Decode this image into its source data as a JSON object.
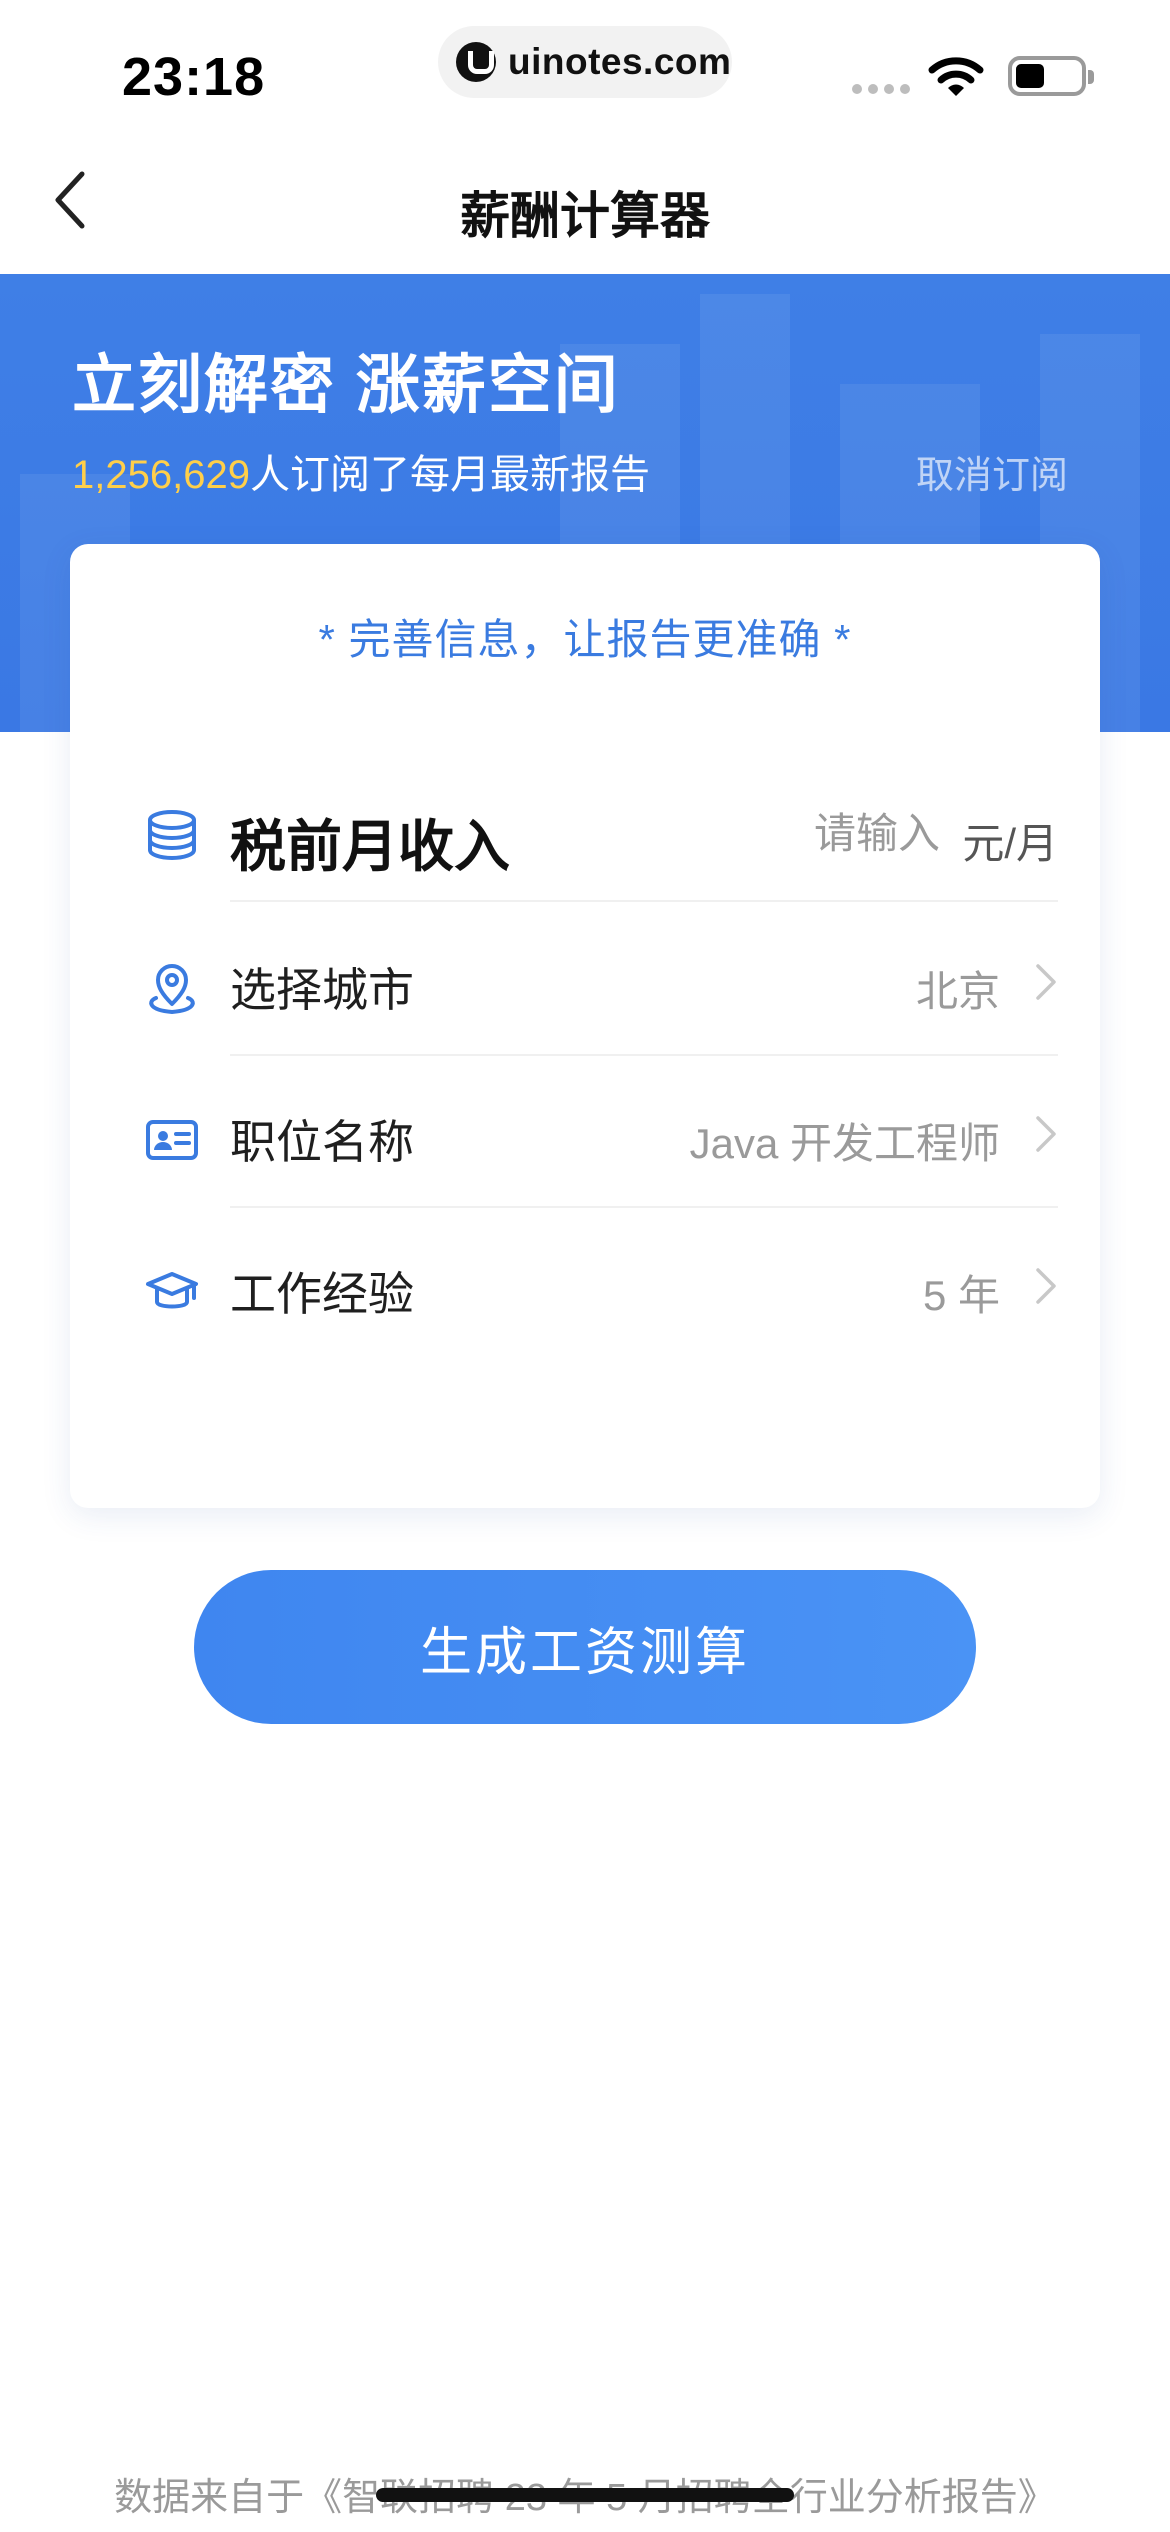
{
  "status_bar": {
    "time": "23:18",
    "url": "uinotes.com",
    "icons": [
      "signal-icon",
      "wifi-icon",
      "battery-icon"
    ]
  },
  "nav": {
    "back_icon": "chevron-left-icon",
    "title": "薪酬计算器"
  },
  "hero": {
    "title": "立刻解密 涨薪空间",
    "subscriber_count": "1,256,629",
    "subscriber_text": "人订阅了每月最新报告",
    "unsubscribe_label": "取消订阅",
    "accent_color": "#ffcf4a",
    "background_color": "#3f7fe6"
  },
  "card": {
    "tip": "* 完善信息，让报告更准确 *",
    "income": {
      "icon": "coins-stack-icon",
      "label": "税前月收入",
      "placeholder": "请输入",
      "value": "",
      "unit": "元/月"
    },
    "fields": [
      {
        "icon": "location-pin-icon",
        "label": "选择城市",
        "value": "北京"
      },
      {
        "icon": "id-card-icon",
        "label": "职位名称",
        "value": "Java 开发工程师"
      },
      {
        "icon": "graduation-cap-icon",
        "label": "工作经验",
        "value": "5 年"
      }
    ]
  },
  "generate_button": {
    "label": "生成工资测算",
    "color": "#4a93f5"
  },
  "footer": {
    "note": "数据来自于《智联招聘 23 年 5 月招聘全行业分析报告》"
  }
}
